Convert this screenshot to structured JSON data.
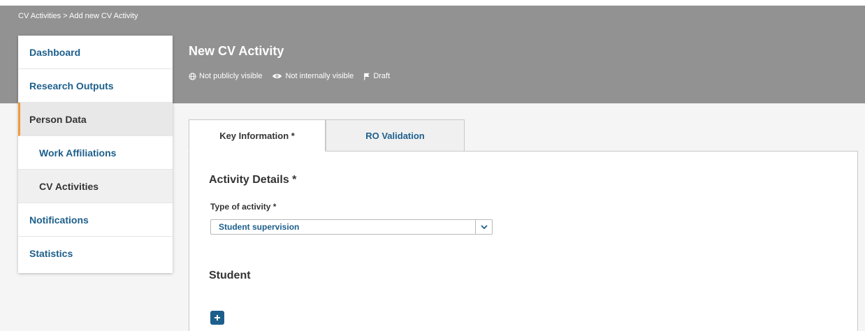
{
  "breadcrumb": "CV Activities > Add new CV Activity",
  "page_title": "New CV Activity",
  "visibility": {
    "public": "Not publicly visible",
    "internal": "Not internally visible",
    "status": "Draft"
  },
  "sidebar": {
    "items": [
      {
        "label": "Dashboard"
      },
      {
        "label": "Research Outputs"
      },
      {
        "label": "Person Data"
      },
      {
        "label": "Work Affiliations"
      },
      {
        "label": "CV Activities"
      },
      {
        "label": "Notifications"
      },
      {
        "label": "Statistics"
      }
    ]
  },
  "tabs": [
    {
      "label": "Key Information *"
    },
    {
      "label": "RO Validation"
    }
  ],
  "form": {
    "section_title": "Activity Details *",
    "type_label": "Type of activity *",
    "type_value": "Student supervision",
    "student_title": "Student"
  },
  "icons": {
    "globe": "globe-icon",
    "eye": "eye-icon",
    "flag": "flag-icon",
    "chevron": "chevron-down-icon",
    "plus": "plus-icon"
  },
  "colors": {
    "header": "#929292",
    "link": "#1d5f8c",
    "accent": "#f29a3a"
  }
}
